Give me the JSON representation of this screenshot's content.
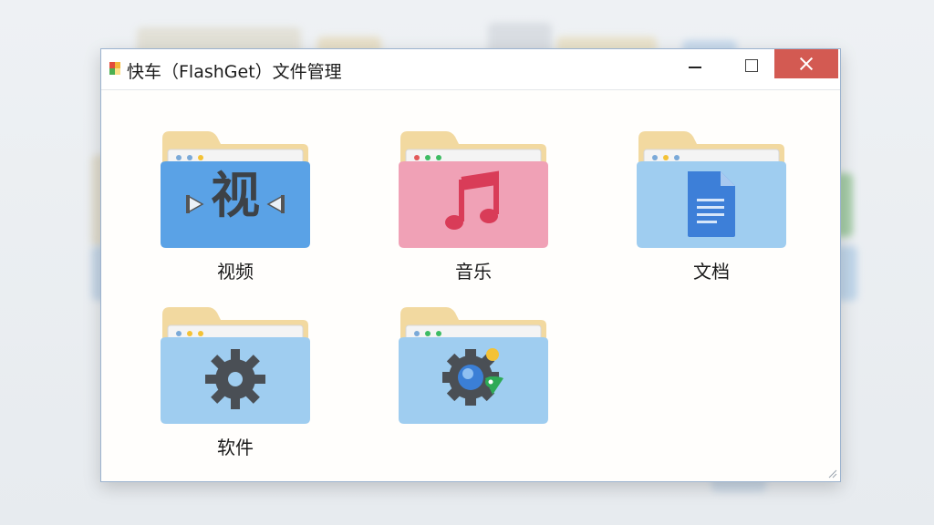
{
  "window": {
    "title": "快车（FlashGet）文件管理"
  },
  "folders": [
    {
      "label": "视频",
      "icon": "video-icon",
      "icon_text": "视",
      "color": "#5aa2e6"
    },
    {
      "label": "音乐",
      "icon": "music-note-icon",
      "color": "#f0a1b6"
    },
    {
      "label": "文档",
      "icon": "document-icon",
      "color": "#9fcdf0"
    },
    {
      "label": "软件",
      "icon": "gear-icon",
      "color": "#9fcdf0"
    },
    {
      "label": "",
      "icon": "settings-gear-globe-icon",
      "color": "#9fcdf0"
    }
  ],
  "colors": {
    "close_button": "#d35a52",
    "folder_tab": "#f2d9a0",
    "window_border": "#9cb3cf"
  }
}
